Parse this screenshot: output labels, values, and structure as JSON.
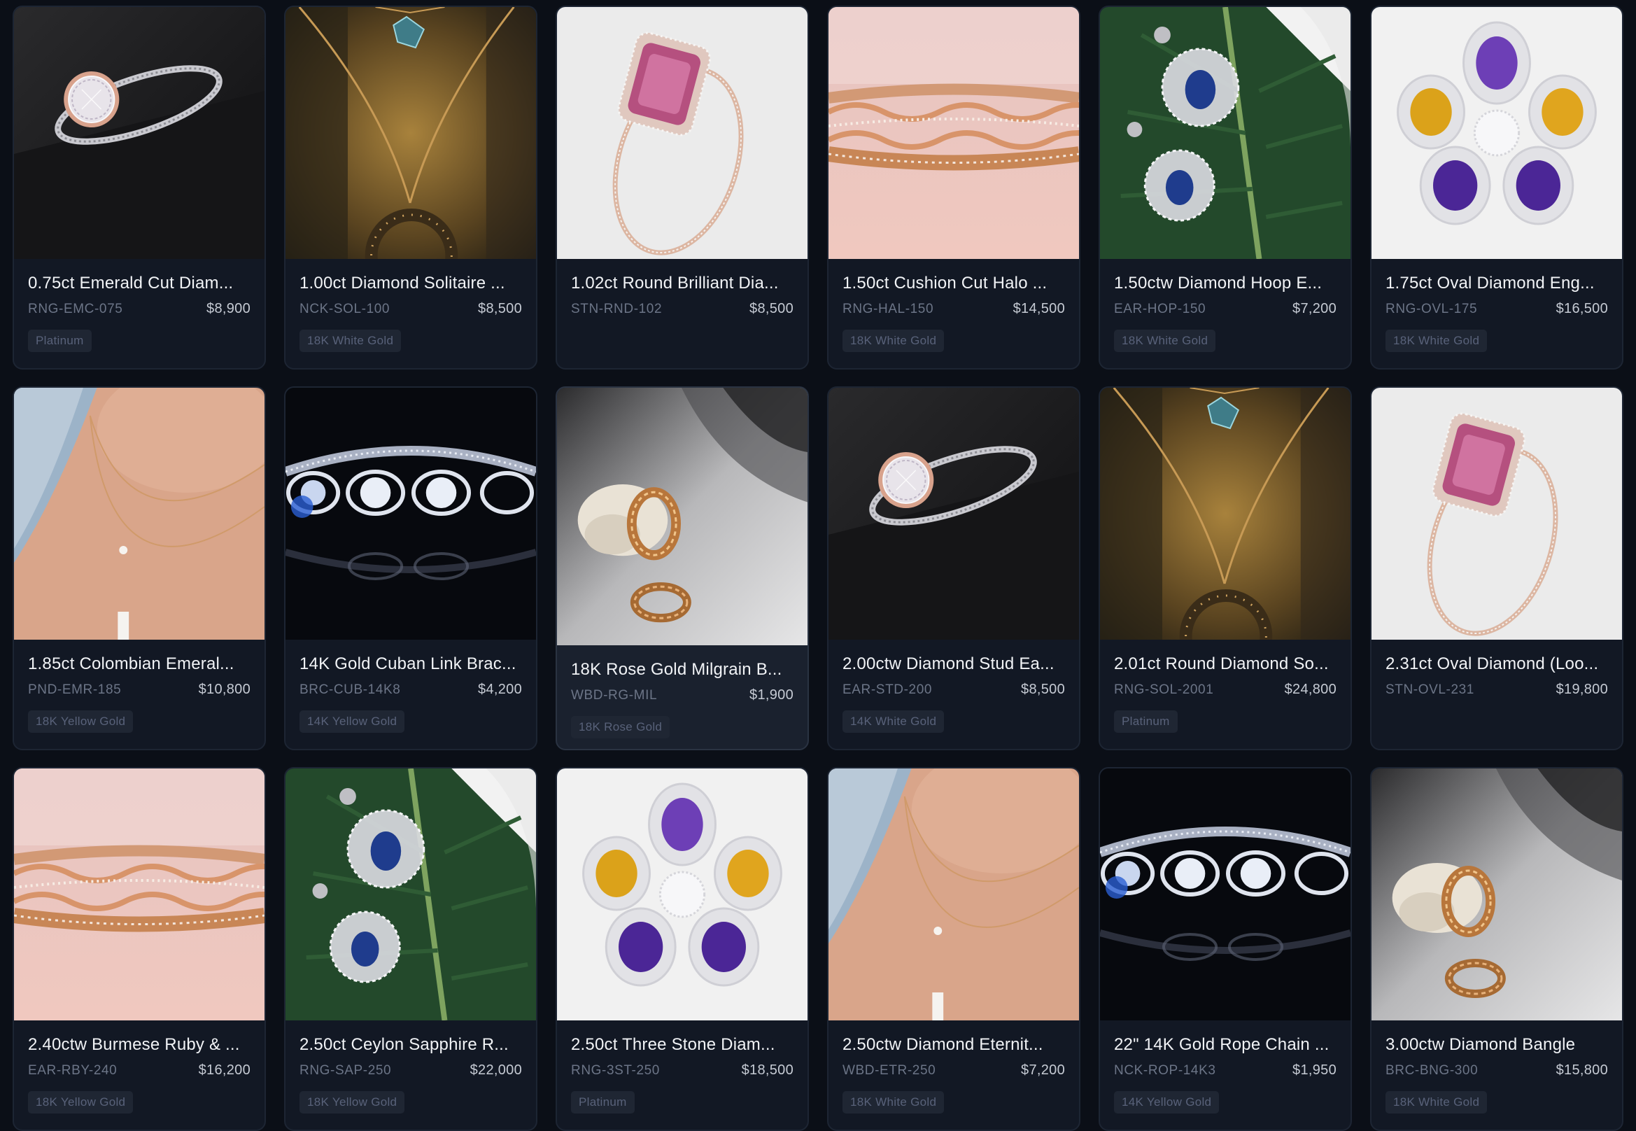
{
  "catalog": {
    "items": [
      {
        "title": "0.75ct Emerald Cut Diam...",
        "sku": "RNG-EMC-075",
        "price": "$8,900",
        "metal": "Platinum",
        "image": "halo-ring-dark"
      },
      {
        "title": "1.00ct Diamond Solitaire ...",
        "sku": "NCK-SOL-100",
        "price": "$8,500",
        "metal": "18K White Gold",
        "image": "pendant-necklace-gold"
      },
      {
        "title": "1.02ct Round Brilliant Dia...",
        "sku": "STN-RND-102",
        "price": "$8,500",
        "metal": "",
        "image": "pink-sapphire-ring"
      },
      {
        "title": "1.50ct Cushion Cut Halo ...",
        "sku": "RNG-HAL-150",
        "price": "$14,500",
        "metal": "18K White Gold",
        "image": "rose-gold-bracelet"
      },
      {
        "title": "1.50ctw Diamond Hoop E...",
        "sku": "EAR-HOP-150",
        "price": "$7,200",
        "metal": "18K White Gold",
        "image": "sapphire-earrings-leaf"
      },
      {
        "title": "1.75ct Oval Diamond Eng...",
        "sku": "RNG-OVL-175",
        "price": "$16,500",
        "metal": "18K White Gold",
        "image": "flower-gem-brooch"
      },
      {
        "title": "1.85ct Colombian Emeral...",
        "sku": "PND-EMR-185",
        "price": "$10,800",
        "metal": "18K Yellow Gold",
        "image": "layered-necklace-neck"
      },
      {
        "title": "14K Gold Cuban Link Brac...",
        "sku": "BRC-CUB-14K8",
        "price": "$4,200",
        "metal": "14K Yellow Gold",
        "image": "diamond-bracelet-dark"
      },
      {
        "title": "18K Rose Gold Milgrain B...",
        "sku": "WBD-RG-MIL",
        "price": "$1,900",
        "metal": "18K Rose Gold",
        "image": "rope-rings-shell"
      },
      {
        "title": "2.00ctw Diamond Stud Ea...",
        "sku": "EAR-STD-200",
        "price": "$8,500",
        "metal": "14K White Gold",
        "image": "halo-ring-dark"
      },
      {
        "title": "2.01ct Round Diamond So...",
        "sku": "RNG-SOL-2001",
        "price": "$24,800",
        "metal": "Platinum",
        "image": "pendant-necklace-gold"
      },
      {
        "title": "2.31ct Oval Diamond (Loo...",
        "sku": "STN-OVL-231",
        "price": "$19,800",
        "metal": "",
        "image": "pink-sapphire-ring"
      },
      {
        "title": "2.40ctw Burmese Ruby & ...",
        "sku": "EAR-RBY-240",
        "price": "$16,200",
        "metal": "18K Yellow Gold",
        "image": "rose-gold-bracelet"
      },
      {
        "title": "2.50ct Ceylon Sapphire R...",
        "sku": "RNG-SAP-250",
        "price": "$22,000",
        "metal": "18K Yellow Gold",
        "image": "sapphire-earrings-leaf"
      },
      {
        "title": "2.50ct Three Stone Diam...",
        "sku": "RNG-3ST-250",
        "price": "$18,500",
        "metal": "Platinum",
        "image": "flower-gem-brooch"
      },
      {
        "title": "2.50ctw Diamond Eternit...",
        "sku": "WBD-ETR-250",
        "price": "$7,200",
        "metal": "18K White Gold",
        "image": "layered-necklace-neck"
      },
      {
        "title": "22\" 14K Gold Rope Chain ...",
        "sku": "NCK-ROP-14K3",
        "price": "$1,950",
        "metal": "14K Yellow Gold",
        "image": "diamond-bracelet-dark"
      },
      {
        "title": "3.00ctw Diamond Bangle",
        "sku": "BRC-BNG-300",
        "price": "$15,800",
        "metal": "18K White Gold",
        "image": "rope-rings-shell"
      }
    ]
  }
}
